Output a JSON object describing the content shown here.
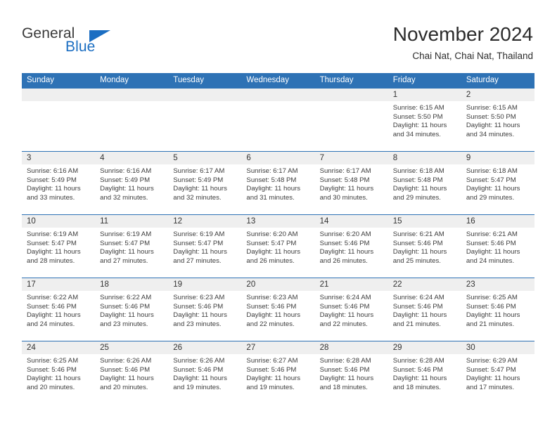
{
  "logo": {
    "word_top": "General",
    "word_bottom": "Blue",
    "accent_color": "#1b6ec2"
  },
  "header": {
    "title": "November 2024",
    "subtitle": "Chai Nat, Chai Nat, Thailand"
  },
  "theme": {
    "header_row_bg": "#2e72b5",
    "daynum_band_bg": "#efefef",
    "cell_bg": "#ffffff",
    "text": "#333333"
  },
  "day_headers": [
    "Sunday",
    "Monday",
    "Tuesday",
    "Wednesday",
    "Thursday",
    "Friday",
    "Saturday"
  ],
  "weeks": [
    [
      {
        "day": "",
        "sunrise": "",
        "sunset": "",
        "daylight1": "",
        "daylight2": ""
      },
      {
        "day": "",
        "sunrise": "",
        "sunset": "",
        "daylight1": "",
        "daylight2": ""
      },
      {
        "day": "",
        "sunrise": "",
        "sunset": "",
        "daylight1": "",
        "daylight2": ""
      },
      {
        "day": "",
        "sunrise": "",
        "sunset": "",
        "daylight1": "",
        "daylight2": ""
      },
      {
        "day": "",
        "sunrise": "",
        "sunset": "",
        "daylight1": "",
        "daylight2": ""
      },
      {
        "day": "1",
        "sunrise": "Sunrise: 6:15 AM",
        "sunset": "Sunset: 5:50 PM",
        "daylight1": "Daylight: 11 hours",
        "daylight2": "and 34 minutes."
      },
      {
        "day": "2",
        "sunrise": "Sunrise: 6:15 AM",
        "sunset": "Sunset: 5:50 PM",
        "daylight1": "Daylight: 11 hours",
        "daylight2": "and 34 minutes."
      }
    ],
    [
      {
        "day": "3",
        "sunrise": "Sunrise: 6:16 AM",
        "sunset": "Sunset: 5:49 PM",
        "daylight1": "Daylight: 11 hours",
        "daylight2": "and 33 minutes."
      },
      {
        "day": "4",
        "sunrise": "Sunrise: 6:16 AM",
        "sunset": "Sunset: 5:49 PM",
        "daylight1": "Daylight: 11 hours",
        "daylight2": "and 32 minutes."
      },
      {
        "day": "5",
        "sunrise": "Sunrise: 6:17 AM",
        "sunset": "Sunset: 5:49 PM",
        "daylight1": "Daylight: 11 hours",
        "daylight2": "and 32 minutes."
      },
      {
        "day": "6",
        "sunrise": "Sunrise: 6:17 AM",
        "sunset": "Sunset: 5:48 PM",
        "daylight1": "Daylight: 11 hours",
        "daylight2": "and 31 minutes."
      },
      {
        "day": "7",
        "sunrise": "Sunrise: 6:17 AM",
        "sunset": "Sunset: 5:48 PM",
        "daylight1": "Daylight: 11 hours",
        "daylight2": "and 30 minutes."
      },
      {
        "day": "8",
        "sunrise": "Sunrise: 6:18 AM",
        "sunset": "Sunset: 5:48 PM",
        "daylight1": "Daylight: 11 hours",
        "daylight2": "and 29 minutes."
      },
      {
        "day": "9",
        "sunrise": "Sunrise: 6:18 AM",
        "sunset": "Sunset: 5:47 PM",
        "daylight1": "Daylight: 11 hours",
        "daylight2": "and 29 minutes."
      }
    ],
    [
      {
        "day": "10",
        "sunrise": "Sunrise: 6:19 AM",
        "sunset": "Sunset: 5:47 PM",
        "daylight1": "Daylight: 11 hours",
        "daylight2": "and 28 minutes."
      },
      {
        "day": "11",
        "sunrise": "Sunrise: 6:19 AM",
        "sunset": "Sunset: 5:47 PM",
        "daylight1": "Daylight: 11 hours",
        "daylight2": "and 27 minutes."
      },
      {
        "day": "12",
        "sunrise": "Sunrise: 6:19 AM",
        "sunset": "Sunset: 5:47 PM",
        "daylight1": "Daylight: 11 hours",
        "daylight2": "and 27 minutes."
      },
      {
        "day": "13",
        "sunrise": "Sunrise: 6:20 AM",
        "sunset": "Sunset: 5:47 PM",
        "daylight1": "Daylight: 11 hours",
        "daylight2": "and 26 minutes."
      },
      {
        "day": "14",
        "sunrise": "Sunrise: 6:20 AM",
        "sunset": "Sunset: 5:46 PM",
        "daylight1": "Daylight: 11 hours",
        "daylight2": "and 26 minutes."
      },
      {
        "day": "15",
        "sunrise": "Sunrise: 6:21 AM",
        "sunset": "Sunset: 5:46 PM",
        "daylight1": "Daylight: 11 hours",
        "daylight2": "and 25 minutes."
      },
      {
        "day": "16",
        "sunrise": "Sunrise: 6:21 AM",
        "sunset": "Sunset: 5:46 PM",
        "daylight1": "Daylight: 11 hours",
        "daylight2": "and 24 minutes."
      }
    ],
    [
      {
        "day": "17",
        "sunrise": "Sunrise: 6:22 AM",
        "sunset": "Sunset: 5:46 PM",
        "daylight1": "Daylight: 11 hours",
        "daylight2": "and 24 minutes."
      },
      {
        "day": "18",
        "sunrise": "Sunrise: 6:22 AM",
        "sunset": "Sunset: 5:46 PM",
        "daylight1": "Daylight: 11 hours",
        "daylight2": "and 23 minutes."
      },
      {
        "day": "19",
        "sunrise": "Sunrise: 6:23 AM",
        "sunset": "Sunset: 5:46 PM",
        "daylight1": "Daylight: 11 hours",
        "daylight2": "and 23 minutes."
      },
      {
        "day": "20",
        "sunrise": "Sunrise: 6:23 AM",
        "sunset": "Sunset: 5:46 PM",
        "daylight1": "Daylight: 11 hours",
        "daylight2": "and 22 minutes."
      },
      {
        "day": "21",
        "sunrise": "Sunrise: 6:24 AM",
        "sunset": "Sunset: 5:46 PM",
        "daylight1": "Daylight: 11 hours",
        "daylight2": "and 22 minutes."
      },
      {
        "day": "22",
        "sunrise": "Sunrise: 6:24 AM",
        "sunset": "Sunset: 5:46 PM",
        "daylight1": "Daylight: 11 hours",
        "daylight2": "and 21 minutes."
      },
      {
        "day": "23",
        "sunrise": "Sunrise: 6:25 AM",
        "sunset": "Sunset: 5:46 PM",
        "daylight1": "Daylight: 11 hours",
        "daylight2": "and 21 minutes."
      }
    ],
    [
      {
        "day": "24",
        "sunrise": "Sunrise: 6:25 AM",
        "sunset": "Sunset: 5:46 PM",
        "daylight1": "Daylight: 11 hours",
        "daylight2": "and 20 minutes."
      },
      {
        "day": "25",
        "sunrise": "Sunrise: 6:26 AM",
        "sunset": "Sunset: 5:46 PM",
        "daylight1": "Daylight: 11 hours",
        "daylight2": "and 20 minutes."
      },
      {
        "day": "26",
        "sunrise": "Sunrise: 6:26 AM",
        "sunset": "Sunset: 5:46 PM",
        "daylight1": "Daylight: 11 hours",
        "daylight2": "and 19 minutes."
      },
      {
        "day": "27",
        "sunrise": "Sunrise: 6:27 AM",
        "sunset": "Sunset: 5:46 PM",
        "daylight1": "Daylight: 11 hours",
        "daylight2": "and 19 minutes."
      },
      {
        "day": "28",
        "sunrise": "Sunrise: 6:28 AM",
        "sunset": "Sunset: 5:46 PM",
        "daylight1": "Daylight: 11 hours",
        "daylight2": "and 18 minutes."
      },
      {
        "day": "29",
        "sunrise": "Sunrise: 6:28 AM",
        "sunset": "Sunset: 5:46 PM",
        "daylight1": "Daylight: 11 hours",
        "daylight2": "and 18 minutes."
      },
      {
        "day": "30",
        "sunrise": "Sunrise: 6:29 AM",
        "sunset": "Sunset: 5:47 PM",
        "daylight1": "Daylight: 11 hours",
        "daylight2": "and 17 minutes."
      }
    ]
  ]
}
